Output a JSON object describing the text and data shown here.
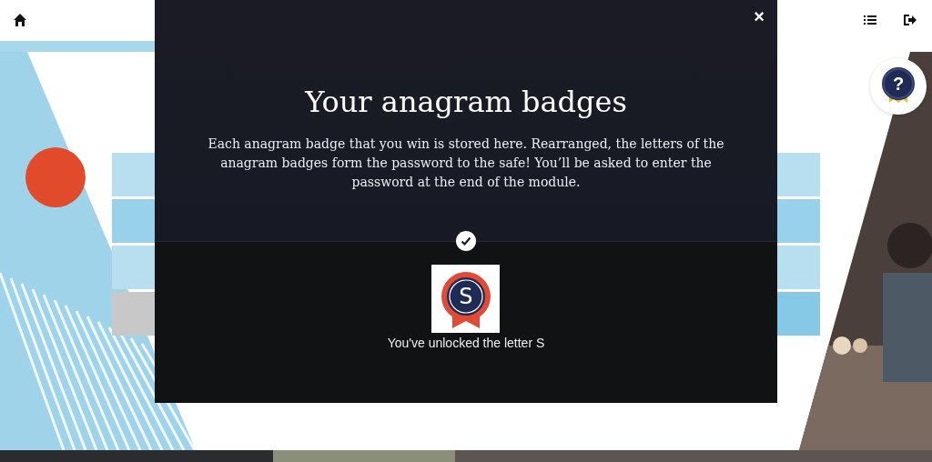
{
  "modal": {
    "close": "×",
    "title": "Your anagram badges",
    "description": "Each anagram badge that you win is stored here. Rearranged, the letters of the anagram badges form the password to the safe! You’ll be asked to enter the password at the end of the module.",
    "badges": [
      {
        "letter": "S",
        "unlocked": true,
        "caption": "You've unlocked the letter S"
      }
    ]
  },
  "help_button": {
    "label": "?"
  }
}
